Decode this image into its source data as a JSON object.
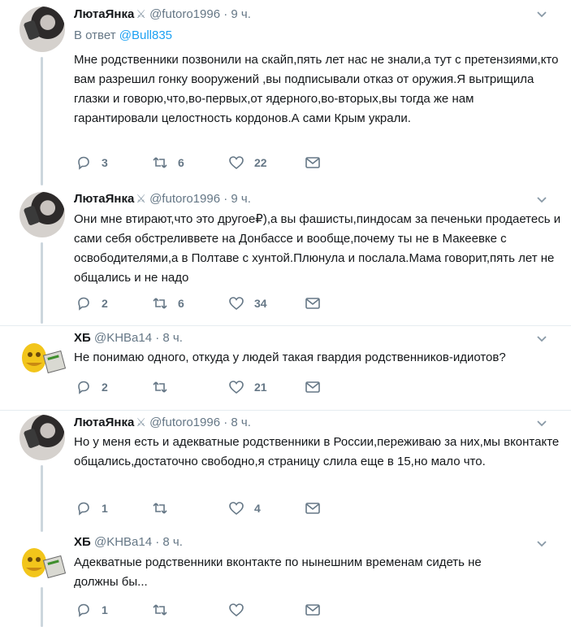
{
  "tweets": [
    {
      "author": "ЛютаЯнка",
      "handle": "@futoro1996",
      "dot": "·",
      "time": "9 ч.",
      "reply_prefix": "В ответ",
      "reply_mention": "@Bull835",
      "text": "Мне родственники позвонили на скайп,пять лет нас не знали,а тут с претензиями,кто вам разрешил гонку вооружений ,вы подписывали отказ от оружия.Я вытрищила глазки и говорю,что,во-первых,от ядерного,во-вторых,вы тогда же нам гарантировали целостность кордонов.А сами Крым украли.",
      "replies": "3",
      "retweets": "6",
      "likes": "22"
    },
    {
      "author": "ЛютаЯнка",
      "handle": "@futoro1996",
      "dot": "·",
      "time": "9 ч.",
      "text": "Они мне втирают,что это другое₽),а вы фашисты,пиндосам за печеньки продаетесь и сами себя обстреливвете на Донбассе и вообще,почему ты не в Макеевке с освободителями,а в Полтаве с хунтой.Плюнула и послала.Мама говорит,пять лет не общались и не надо",
      "replies": "2",
      "retweets": "6",
      "likes": "34"
    },
    {
      "author": "ХБ",
      "handle": "@KHBa14",
      "dot": "·",
      "time": "8 ч.",
      "text": "Не понимаю одного, откуда у людей такая гвардия родственников-идиотов?",
      "replies": "2",
      "retweets": "",
      "likes": "21"
    },
    {
      "author": "ЛютаЯнка",
      "handle": "@futoro1996",
      "dot": "·",
      "time": "8 ч.",
      "text": "Но у меня есть и адекватные родственники в России,переживаю за них,мы вконтакте общались,достаточно свободно,я страницу слила еще в 15,но мало что.",
      "replies": "1",
      "retweets": "",
      "likes": "4"
    },
    {
      "author": "ХБ",
      "handle": "@KHBa14",
      "dot": "·",
      "time": "8 ч.",
      "text": "Адекватные родственники вконтакте по нынешним временам сидеть не должны бы...",
      "replies": "1",
      "retweets": "",
      "likes": ""
    }
  ],
  "colors": {
    "accent": "#1da1f2",
    "muted": "#657786",
    "thread": "#ccd6dd"
  }
}
